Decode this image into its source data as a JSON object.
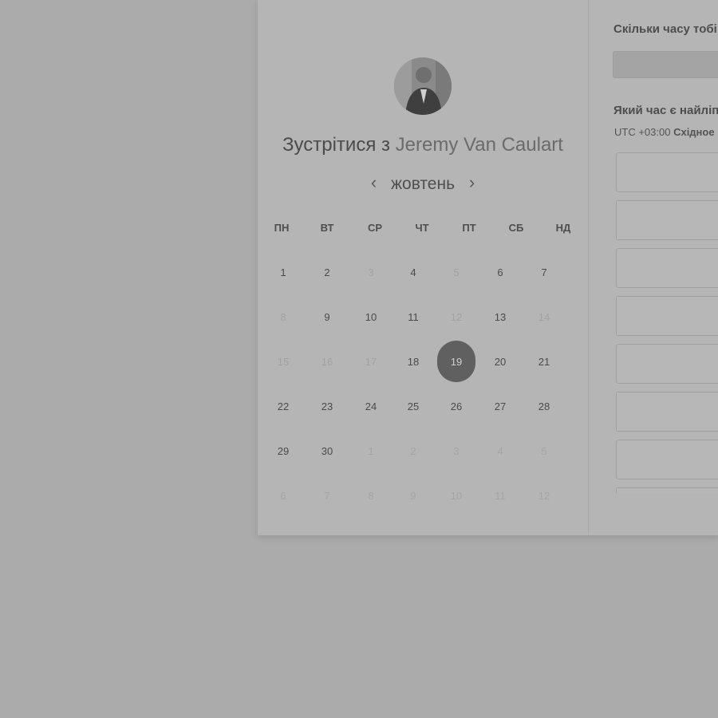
{
  "meeting": {
    "title_prefix": "Зустрітися з",
    "host_name": "Jeremy Van Caulart"
  },
  "calendar": {
    "month": "жовтень",
    "prev_icon": "chevron-left-icon",
    "next_icon": "chevron-right-icon",
    "weekdays": [
      "ПН",
      "ВТ",
      "СР",
      "ЧТ",
      "ПТ",
      "СБ",
      "НД"
    ],
    "selected_day": "19",
    "weeks": [
      [
        {
          "d": "1",
          "s": "available"
        },
        {
          "d": "2",
          "s": "available"
        },
        {
          "d": "3",
          "s": "unavailable"
        },
        {
          "d": "4",
          "s": "available"
        },
        {
          "d": "5",
          "s": "unavailable"
        },
        {
          "d": "6",
          "s": "available"
        },
        {
          "d": "7",
          "s": "available"
        }
      ],
      [
        {
          "d": "8",
          "s": "unavailable"
        },
        {
          "d": "9",
          "s": "available"
        },
        {
          "d": "10",
          "s": "available"
        },
        {
          "d": "11",
          "s": "available"
        },
        {
          "d": "12",
          "s": "unavailable"
        },
        {
          "d": "13",
          "s": "available"
        },
        {
          "d": "14",
          "s": "unavailable"
        }
      ],
      [
        {
          "d": "15",
          "s": "unavailable"
        },
        {
          "d": "16",
          "s": "unavailable"
        },
        {
          "d": "17",
          "s": "unavailable"
        },
        {
          "d": "18",
          "s": "available"
        },
        {
          "d": "19",
          "s": "selected"
        },
        {
          "d": "20",
          "s": "available"
        },
        {
          "d": "21",
          "s": "available"
        }
      ],
      [
        {
          "d": "22",
          "s": "available"
        },
        {
          "d": "23",
          "s": "available"
        },
        {
          "d": "24",
          "s": "available"
        },
        {
          "d": "25",
          "s": "available"
        },
        {
          "d": "26",
          "s": "available"
        },
        {
          "d": "27",
          "s": "available"
        },
        {
          "d": "28",
          "s": "available"
        }
      ],
      [
        {
          "d": "29",
          "s": "available"
        },
        {
          "d": "30",
          "s": "available"
        },
        {
          "d": "1",
          "s": "other-month"
        },
        {
          "d": "2",
          "s": "other-month"
        },
        {
          "d": "3",
          "s": "other-month"
        },
        {
          "d": "4",
          "s": "other-month"
        },
        {
          "d": "5",
          "s": "other-month"
        }
      ],
      [
        {
          "d": "6",
          "s": "other-month"
        },
        {
          "d": "7",
          "s": "other-month"
        },
        {
          "d": "8",
          "s": "other-month"
        },
        {
          "d": "9",
          "s": "other-month"
        },
        {
          "d": "10",
          "s": "other-month"
        },
        {
          "d": "11",
          "s": "other-month"
        },
        {
          "d": "12",
          "s": "other-month"
        }
      ]
    ]
  },
  "duration": {
    "label": "Скільки часу тобі"
  },
  "best_time": {
    "label": "Який час є найліп",
    "tz_offset": "UTC +03:00",
    "tz_name": "Східное"
  },
  "time_slots": [
    "",
    "",
    "",
    "",
    "",
    "",
    "",
    ""
  ],
  "colors": {
    "page_bg": "#ababab",
    "card_bg": "#b5b5b5",
    "selected_day_bg": "#606060",
    "text_primary": "#4a4a4a"
  }
}
